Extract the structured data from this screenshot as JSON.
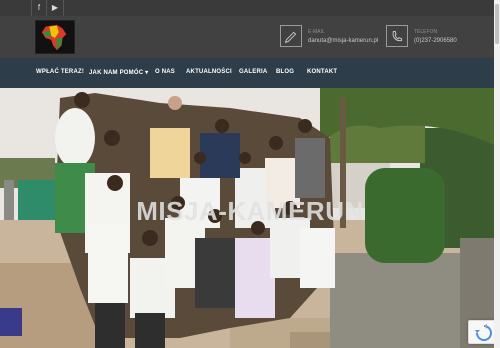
{
  "topbar": {
    "social": [
      "facebook-icon",
      "youtube-icon"
    ]
  },
  "header": {
    "email": {
      "label": "E-MAIL",
      "value": "danuta@misja-kamerun.pl",
      "icon": "pencil-icon"
    },
    "phone": {
      "label": "TELEFON",
      "value": "(0)237-2906580",
      "icon": "phone-icon"
    }
  },
  "nav": {
    "items": [
      "WPŁAĆ TERAZ!",
      "JAK NAM POMÓC ▾",
      "O NAS",
      "AKTUALNOŚCI",
      "GALERIA",
      "BLOG",
      "KONTAKT"
    ]
  },
  "hero": {
    "title": "MISJA-KAMERUN"
  },
  "colors": {
    "topbar": "#3a3a3a",
    "header": "#414141",
    "nav": "#2d3e4a"
  }
}
